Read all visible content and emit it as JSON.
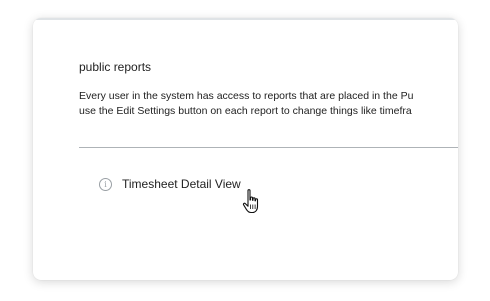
{
  "section": {
    "title": "public reports",
    "description_line1": "Every user in the system has access to reports that are placed in the Pu",
    "description_line2": "use the Edit Settings button on each report to change things like timefra"
  },
  "reports": [
    {
      "label": "Timesheet Detail View",
      "icon": "info-icon"
    }
  ],
  "cursor": {
    "icon": "hand-pointer-icon"
  }
}
